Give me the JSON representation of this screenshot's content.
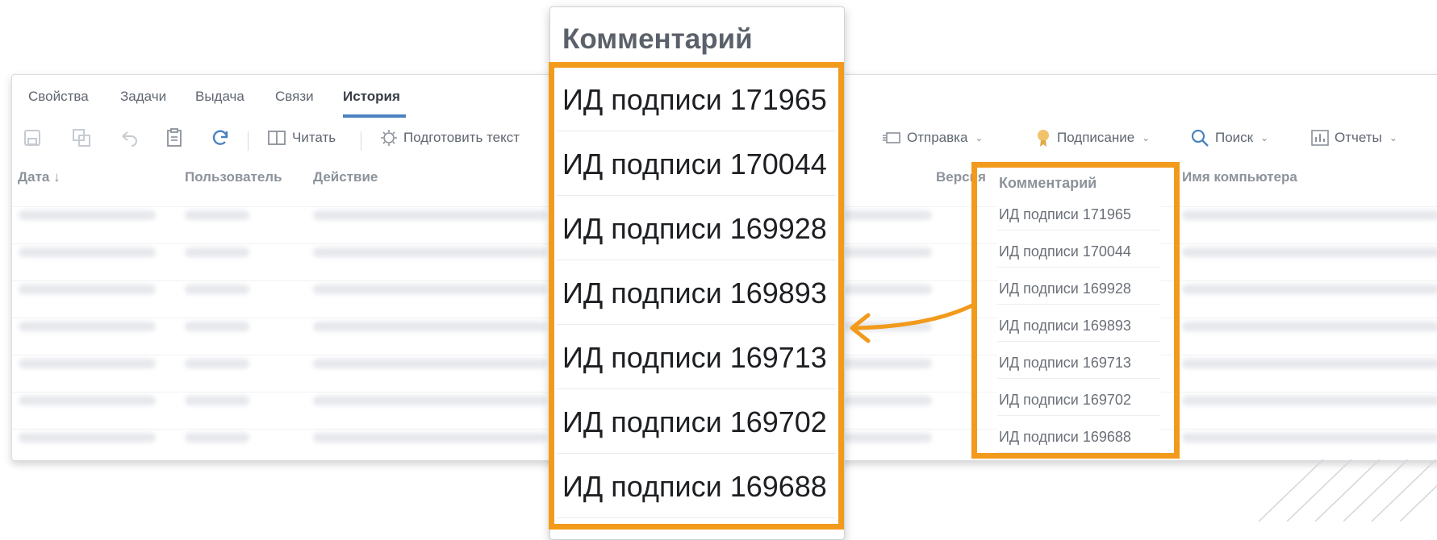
{
  "tabs": [
    "Свойства",
    "Задачи",
    "Выдача",
    "Связи",
    "История"
  ],
  "active_tab": "История",
  "toolbar": {
    "read_label": "Читать",
    "prepare_text_label": "Подготовить текст",
    "send_label": "Отправка",
    "sign_label": "Подписание",
    "search_label": "Поиск",
    "reports_label": "Отчеты"
  },
  "grid": {
    "columns": {
      "date": "Дата",
      "sort_glyph": "↓",
      "user": "Пользователь",
      "action": "Действие",
      "version": "Версия",
      "comment": "Комментарий",
      "computer": "Имя компьютера"
    },
    "comments": [
      "ИД подписи 171965",
      "ИД подписи 170044",
      "ИД подписи 169928",
      "ИД подписи 169893",
      "ИД подписи 169713",
      "ИД подписи 169702",
      "ИД подписи 169688"
    ]
  },
  "zoom": {
    "title": "Комментарий",
    "comments": [
      "ИД подписи 171965",
      "ИД подписи 170044",
      "ИД подписи 169928",
      "ИД подписи 169893",
      "ИД подписи 169713",
      "ИД подписи 169702",
      "ИД подписи 169688"
    ]
  },
  "colors": {
    "highlight": "#f29a1c",
    "tab_active_underline": "#4a82c0",
    "text_muted": "#8d939b"
  }
}
